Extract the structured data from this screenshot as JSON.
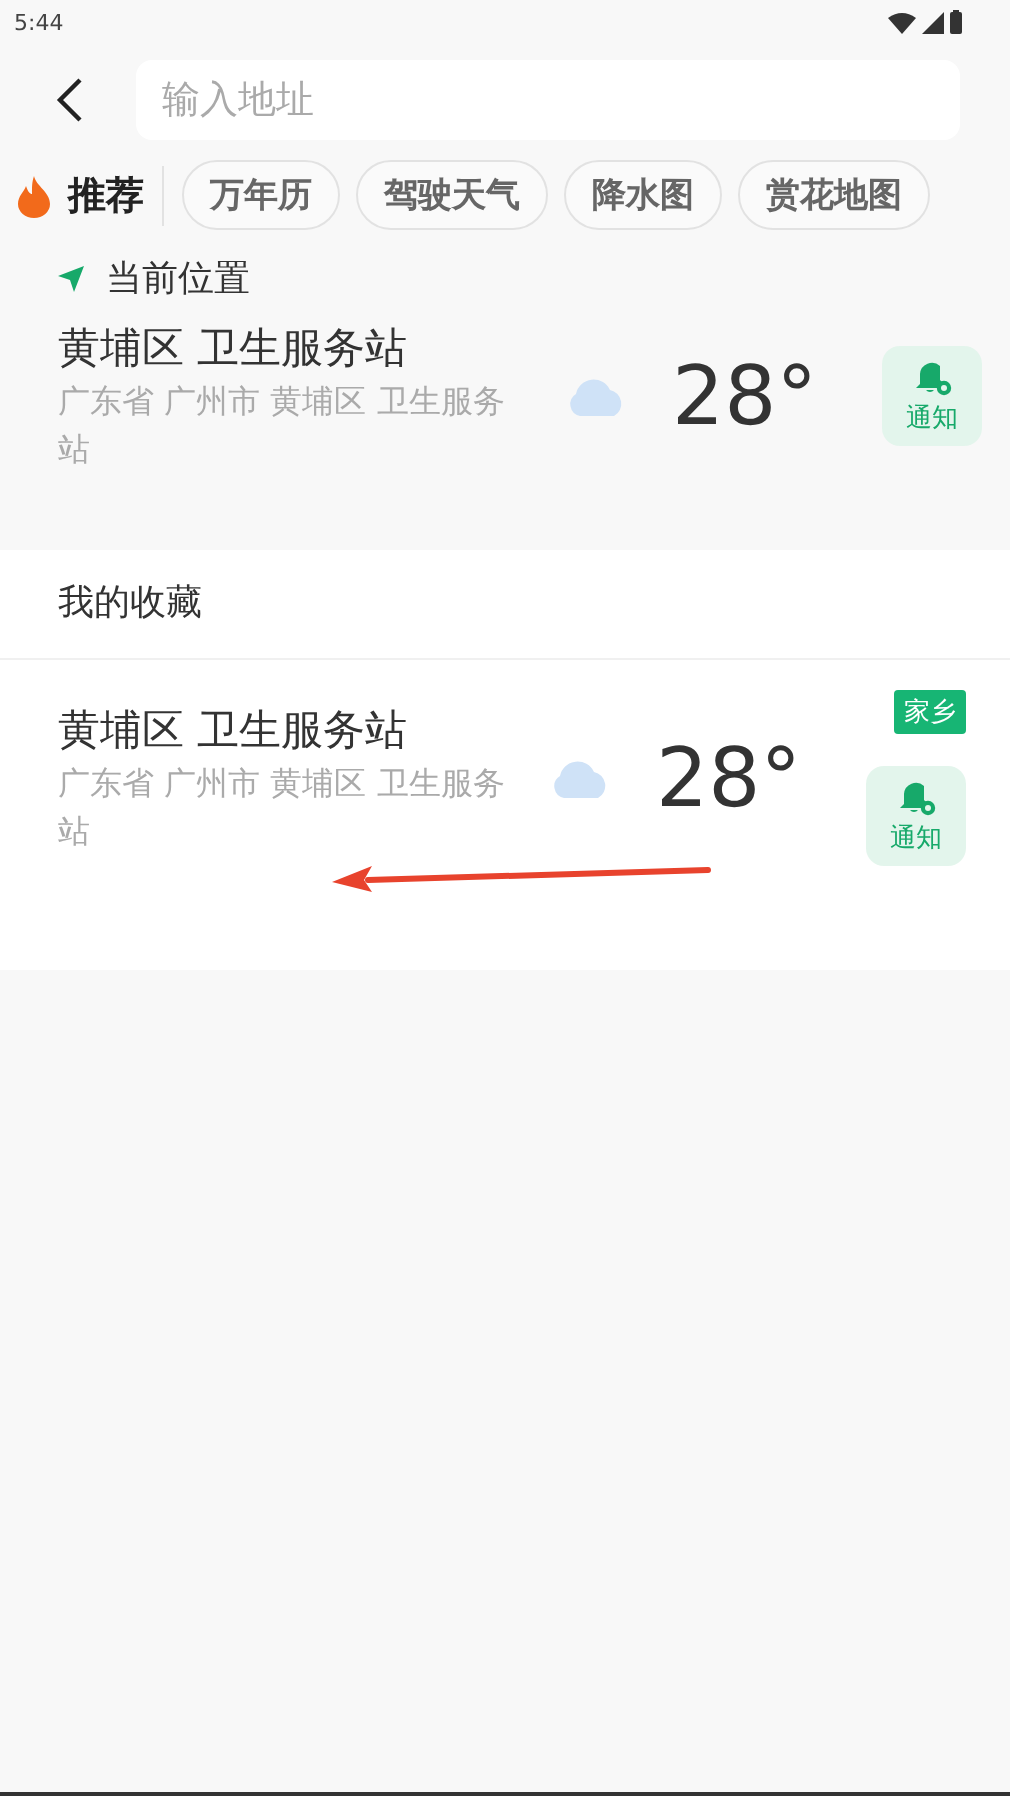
{
  "status_bar": {
    "time": "5:44"
  },
  "search": {
    "placeholder": "输入地址"
  },
  "recommend": {
    "label": "推荐"
  },
  "chips": [
    "万年历",
    "驾驶天气",
    "降水图",
    "赏花地图"
  ],
  "current": {
    "heading": "当前位置",
    "location": {
      "name": "黄埔区 卫生服务站",
      "address": "广东省 广州市 黄埔区 卫生服务站",
      "temperature": "28°",
      "notify_label": "通知"
    }
  },
  "favorites": {
    "heading": "我的收藏",
    "items": [
      {
        "tag": "家乡",
        "name": "黄埔区 卫生服务站",
        "address": "广东省 广州市 黄埔区 卫生服务站",
        "temperature": "28°",
        "notify_label": "通知"
      }
    ]
  }
}
